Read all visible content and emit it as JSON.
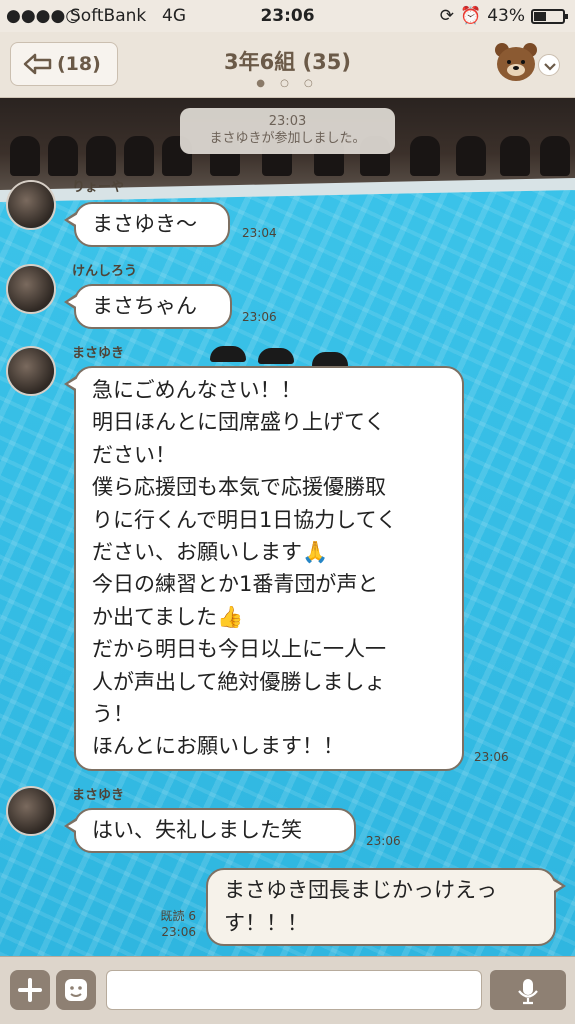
{
  "status": {
    "signal": "●●●●○",
    "carrier": "SoftBank",
    "network": "4G",
    "time": "23:06",
    "battery": "43%",
    "battery_level": 0.43
  },
  "header": {
    "back_count": "(18)",
    "title": "3年6組 (35)",
    "page_dots": "● ○ ○"
  },
  "system_message": {
    "time": "23:03",
    "text": "まさゆきが参加しました。"
  },
  "messages": [
    {
      "sender": "りょーや",
      "lines": [
        "まさゆき〜"
      ],
      "time": "23:04"
    },
    {
      "sender": "けんしろう",
      "lines": [
        "まさちゃん"
      ],
      "time": "23:06"
    },
    {
      "sender": "まさゆき",
      "lines": [
        "急にごめんなさい！！",
        "明日ほんとに団席盛り上げてく",
        "ださい！",
        "僕ら応援団も本気で応援優勝取",
        "りに行くんで明日1日協力してく",
        "ださい、お願いします🙏",
        "今日の練習とか1番青団が声と",
        "か出てました👍",
        "だから明日も今日以上に一人一",
        "人が声出して絶対優勝しましょ",
        "う！",
        "ほんとにお願いします！！"
      ],
      "time": "23:06"
    },
    {
      "sender": "まさゆき",
      "lines": [
        "はい、失礼しました笑"
      ],
      "time": "23:06"
    }
  ],
  "outgoing": {
    "lines": [
      "まさゆき団長まじかっけえっ",
      "す！！！"
    ],
    "read": "既読 6",
    "time": "23:06"
  }
}
